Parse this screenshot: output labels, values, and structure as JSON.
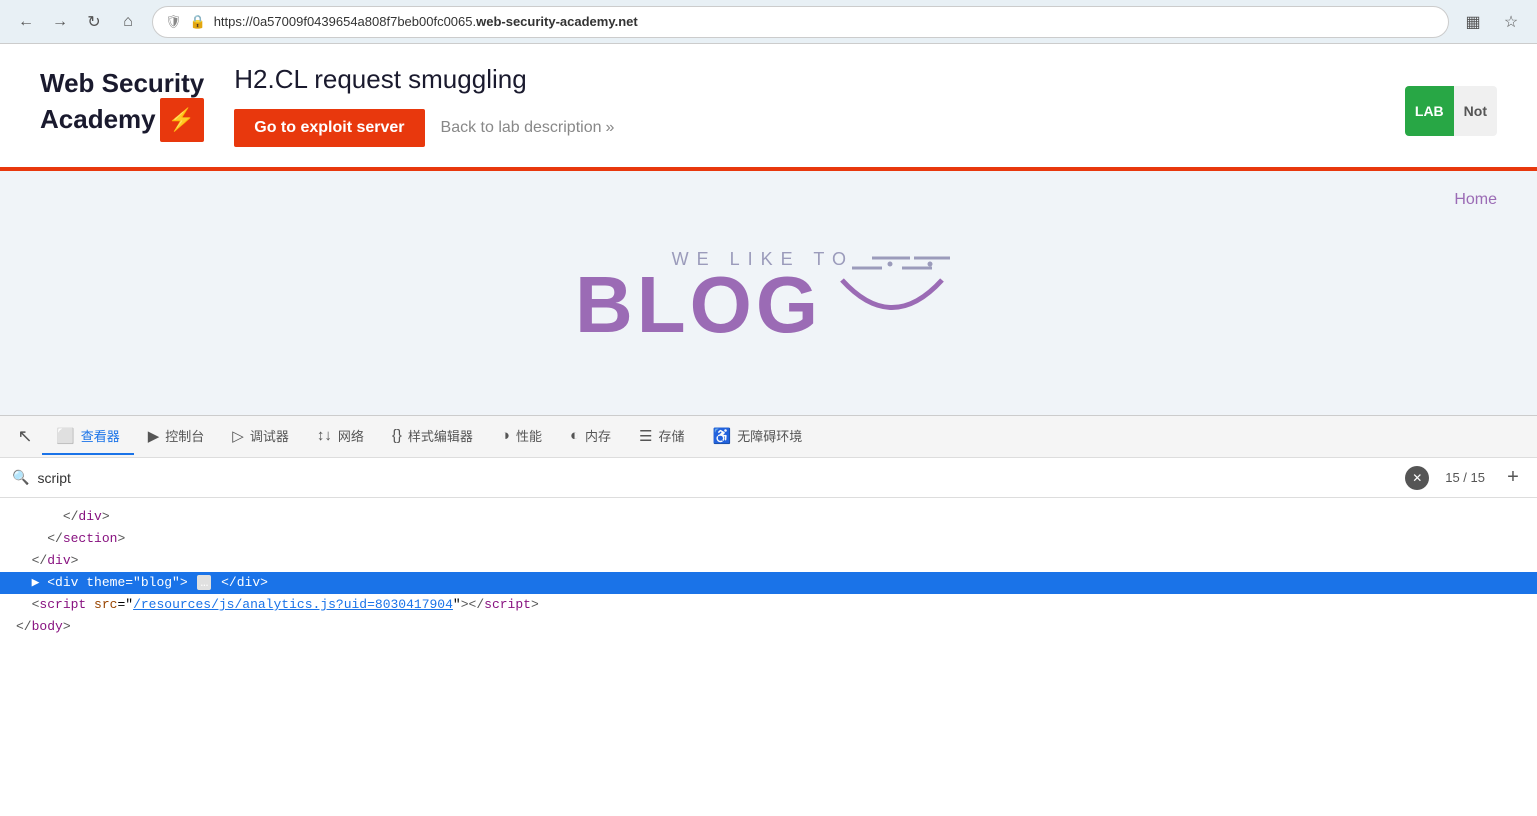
{
  "browser": {
    "url_prefix": "https://0a57009f0439654a808f7beb00fc0065.",
    "url_domain": "web-security-academy.net",
    "nav": {
      "back": "←",
      "forward": "→",
      "reload": "↻",
      "home": "⌂"
    },
    "icons": {
      "qr": "▦",
      "star": "☆",
      "shield": "🛡",
      "lock": "🔒"
    }
  },
  "header": {
    "logo_line1": "Web Security",
    "logo_line2": "Academy",
    "logo_icon": "⚡",
    "lab_title": "H2.CL request smuggling",
    "exploit_btn": "Go to exploit server",
    "back_link": "Back to lab description",
    "back_chevron": "»",
    "lab_badge": "LAB",
    "lab_status": "Not"
  },
  "blog": {
    "nav_home": "Home",
    "we_like_to": "WE LIKE TO",
    "title": "BLOG"
  },
  "devtools": {
    "tabs": [
      {
        "id": "inspector",
        "icon": "⬜",
        "label": "查看器",
        "active": true
      },
      {
        "id": "console",
        "icon": "▶",
        "label": "控制台",
        "active": false
      },
      {
        "id": "debugger",
        "icon": "▷",
        "label": "调试器",
        "active": false
      },
      {
        "id": "network",
        "icon": "↕",
        "label": "网络",
        "active": false
      },
      {
        "id": "style-editor",
        "icon": "{}",
        "label": "样式编辑器",
        "active": false
      },
      {
        "id": "performance",
        "icon": "◑",
        "label": "性能",
        "active": false
      },
      {
        "id": "memory",
        "icon": "◐",
        "label": "内存",
        "active": false
      },
      {
        "id": "storage",
        "icon": "☰",
        "label": "存储",
        "active": false
      },
      {
        "id": "accessibility",
        "icon": "♿",
        "label": "无障碍环境",
        "active": false
      }
    ],
    "search": {
      "value": "script",
      "placeholder": "script",
      "count": "15 / 15"
    },
    "code_lines": [
      {
        "id": "line1",
        "indent": "      ",
        "content": "</div>",
        "selected": false
      },
      {
        "id": "line2",
        "indent": "    ",
        "content": "</section>",
        "selected": false
      },
      {
        "id": "line3",
        "indent": "  ",
        "content": "</div>",
        "selected": false
      },
      {
        "id": "line4",
        "indent": "  ",
        "content": "<div theme=\"blog\"> … </div>",
        "selected": true,
        "has_triangle": true
      },
      {
        "id": "line5",
        "indent": "  ",
        "content_parts": [
          "<script src=\"",
          "/resources/js/analytics.js?uid=8030417904",
          "\"></",
          "script",
          ">"
        ],
        "selected": false
      },
      {
        "id": "line6",
        "indent": "",
        "content": "</body>",
        "selected": false
      }
    ]
  }
}
